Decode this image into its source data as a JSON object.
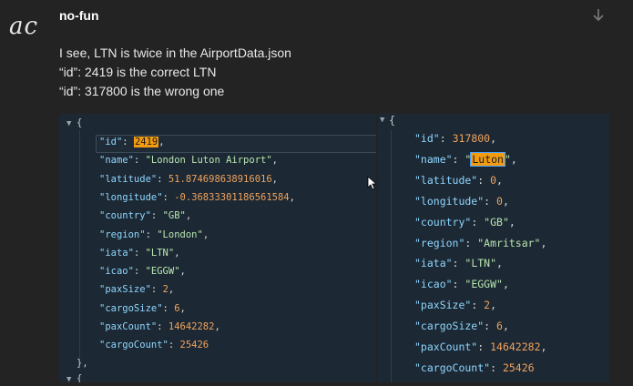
{
  "post": {
    "avatar_text": "ac",
    "username": "no-fun",
    "message_lines": [
      "I see, LTN is twice in the AirportData.json",
      "“id”: 2419 is the correct LTN",
      "“id”: 317800 is the wrong one"
    ]
  },
  "left_panel": {
    "toggle": "▼",
    "open_brace": "{",
    "close_brace": "},",
    "next_toggle": "▼",
    "next_brace": "{",
    "lines": [
      {
        "key": "\"id\"",
        "value": "2419",
        "type": "num",
        "highlight": true
      },
      {
        "key": "\"name\"",
        "value": "\"London Luton Airport\"",
        "type": "str"
      },
      {
        "key": "\"latitude\"",
        "value": "51.874698638916016",
        "type": "num"
      },
      {
        "key": "\"longitude\"",
        "value": "-0.36833301186561584",
        "type": "num"
      },
      {
        "key": "\"country\"",
        "value": "\"GB\"",
        "type": "str"
      },
      {
        "key": "\"region\"",
        "value": "\"London\"",
        "type": "str"
      },
      {
        "key": "\"iata\"",
        "value": "\"LTN\"",
        "type": "str"
      },
      {
        "key": "\"icao\"",
        "value": "\"EGGW\"",
        "type": "str"
      },
      {
        "key": "\"paxSize\"",
        "value": "2",
        "type": "num"
      },
      {
        "key": "\"cargoSize\"",
        "value": "6",
        "type": "num"
      },
      {
        "key": "\"paxCount\"",
        "value": "14642282",
        "type": "num"
      },
      {
        "key": "\"cargoCount\"",
        "value": "25426",
        "type": "num",
        "last": true
      }
    ]
  },
  "right_panel": {
    "toggle": "▼",
    "open_brace": "{",
    "lines": [
      {
        "key": "\"id\"",
        "value": "317800",
        "type": "num"
      },
      {
        "key": "\"name\"",
        "value": "Luton",
        "type": "str",
        "highlight": true,
        "quoted_hl": true
      },
      {
        "key": "\"latitude\"",
        "value": "0",
        "type": "num"
      },
      {
        "key": "\"longitude\"",
        "value": "0",
        "type": "num"
      },
      {
        "key": "\"country\"",
        "value": "\"GB\"",
        "type": "str"
      },
      {
        "key": "\"region\"",
        "value": "\"Amritsar\"",
        "type": "str"
      },
      {
        "key": "\"iata\"",
        "value": "\"LTN\"",
        "type": "str"
      },
      {
        "key": "\"icao\"",
        "value": "\"EGGW\"",
        "type": "str"
      },
      {
        "key": "\"paxSize\"",
        "value": "2",
        "type": "num"
      },
      {
        "key": "\"cargoSize\"",
        "value": "6",
        "type": "num"
      },
      {
        "key": "\"paxCount\"",
        "value": "14642282",
        "type": "num"
      },
      {
        "key": "\"cargoCount\"",
        "value": "25426",
        "type": "num",
        "last": true
      }
    ]
  },
  "colors": {
    "background": "#232323",
    "panel": "#1c2833",
    "key": "#8fd6ff",
    "highlight": "#f39c12"
  },
  "icons": {
    "arrow": "arrow-down-icon",
    "cursor": "mouse-pointer-icon"
  }
}
